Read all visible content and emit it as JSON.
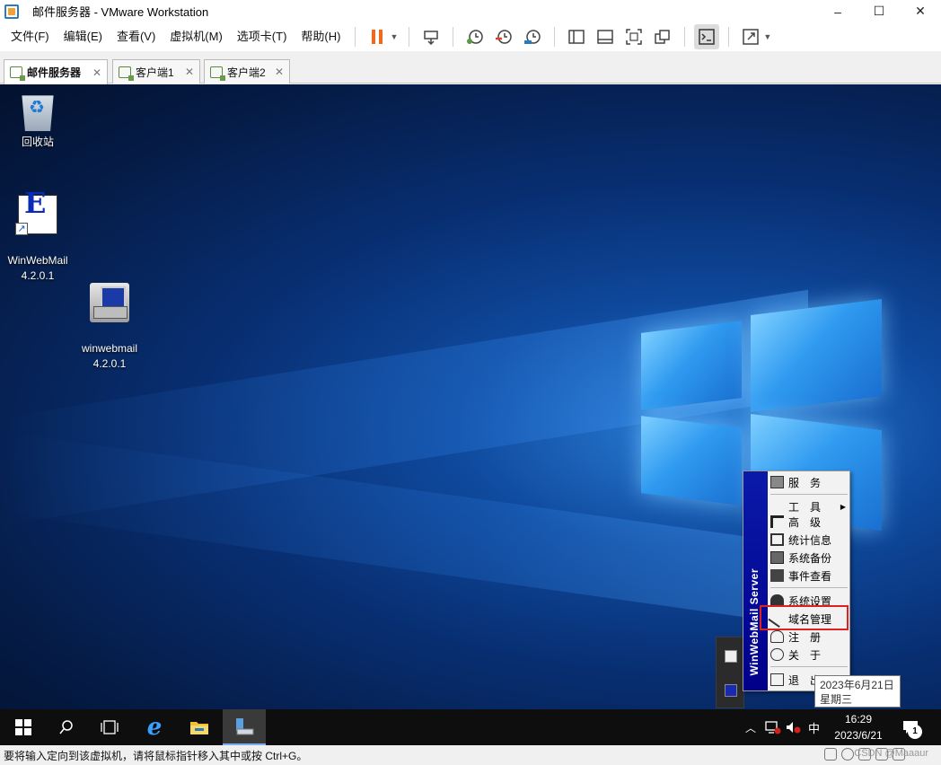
{
  "window": {
    "title": "邮件服务器 - VMware Workstation",
    "controls": [
      "–",
      "☐",
      "✕"
    ]
  },
  "menu": [
    "文件(F)",
    "编辑(E)",
    "查看(V)",
    "虚拟机(M)",
    "选项卡(T)",
    "帮助(H)"
  ],
  "tabs": [
    {
      "label": "邮件服务器",
      "close": "✕"
    },
    {
      "label": "客户端1",
      "close": "✕"
    },
    {
      "label": "客户端2",
      "close": "✕"
    }
  ],
  "desktop_icons": [
    {
      "label": "回收站"
    },
    {
      "label": "WinWebMail\n4.2.0.1"
    },
    {
      "label": "winwebmail\n4.2.0.1"
    }
  ],
  "context_menu": {
    "sidebar_text": "WinWebMail Server",
    "items": [
      "服　务",
      "工　具",
      "高　级",
      "统计信息",
      "系统备份",
      "事件查看",
      "系统设置",
      "域名管理",
      "注　册",
      "关　于",
      "退　出"
    ]
  },
  "tooltip": {
    "date": "2023年6月21日",
    "weekday": "星期三"
  },
  "taskbar": {
    "ime": "中",
    "clock_time": "16:29",
    "clock_date": "2023/6/21",
    "notification_count": "1"
  },
  "statusbar": {
    "text": "要将输入定向到该虚拟机，请将鼠标指针移入其中或按 Ctrl+G。",
    "watermark": "CSDN @Maaaur"
  },
  "colors": {
    "accent_red": "#e02020",
    "menu_sidebar": "#0a1aa8",
    "pause_orange": "#f06a1a"
  }
}
